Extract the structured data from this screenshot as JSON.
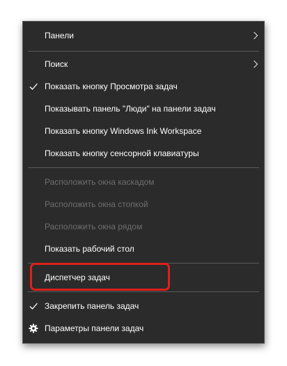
{
  "context_menu": {
    "items": [
      {
        "label": "Панели",
        "checked": false,
        "submenu": true,
        "enabled": true
      },
      {
        "label": "Поиск",
        "checked": false,
        "submenu": true,
        "enabled": true
      },
      {
        "label": "Показать кнопку Просмотра задач",
        "checked": true,
        "submenu": false,
        "enabled": true
      },
      {
        "label": "Показывать панель \"Люди\" на панели задач",
        "checked": false,
        "submenu": false,
        "enabled": true
      },
      {
        "label": "Показать кнопку Windows Ink Workspace",
        "checked": false,
        "submenu": false,
        "enabled": true
      },
      {
        "label": "Показать кнопку сенсорной клавиатуры",
        "checked": false,
        "submenu": false,
        "enabled": true
      },
      {
        "label": "Расположить окна каскадом",
        "checked": false,
        "submenu": false,
        "enabled": false
      },
      {
        "label": "Расположить окна стопкой",
        "checked": false,
        "submenu": false,
        "enabled": false
      },
      {
        "label": "Расположить окна рядом",
        "checked": false,
        "submenu": false,
        "enabled": false
      },
      {
        "label": "Показать рабочий стол",
        "checked": false,
        "submenu": false,
        "enabled": true
      },
      {
        "label": "Диспетчер задач",
        "checked": false,
        "submenu": false,
        "enabled": true,
        "highlighted": true
      },
      {
        "label": "Закрепить панель задач",
        "checked": true,
        "submenu": false,
        "enabled": true
      },
      {
        "label": "Параметры панели задач",
        "checked": false,
        "submenu": false,
        "enabled": true,
        "icon": "gear-icon"
      }
    ]
  },
  "colors": {
    "menu_background": "#2b2b2b",
    "text": "#ffffff",
    "disabled_text": "#6e6e6e",
    "highlight_ring": "#e0201b"
  }
}
